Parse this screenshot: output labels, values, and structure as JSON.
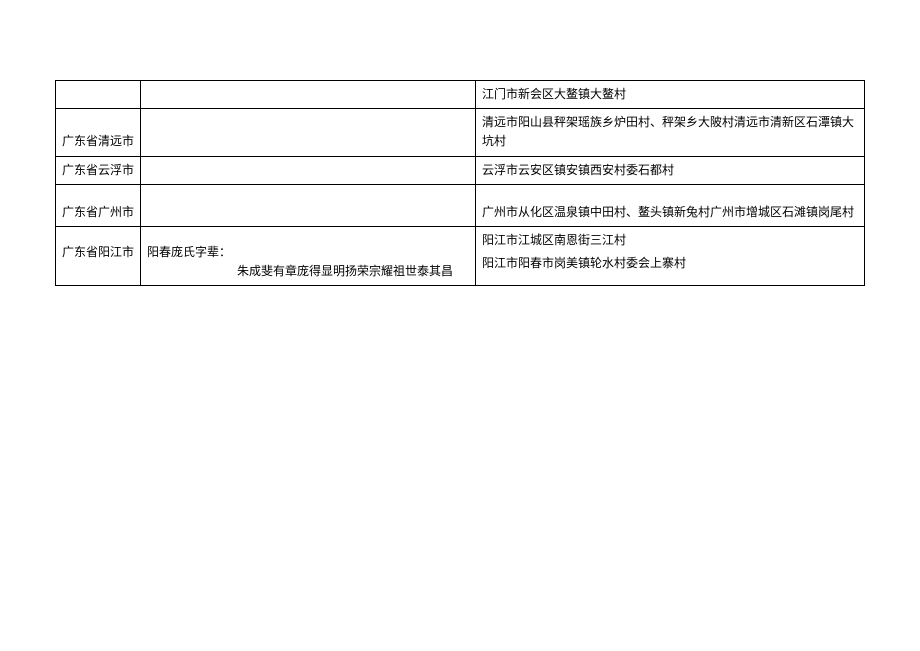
{
  "rows": [
    {
      "col1": "",
      "col2": "",
      "col3": "江门市新会区大鳌镇大鳌村"
    },
    {
      "col1": "广东省清远市",
      "col2": "",
      "col3": "清远市阳山县秤架瑶族乡炉田村、秤架乡大陂村清远市清新区石潭镇大坑村"
    },
    {
      "col1": "广东省云浮市",
      "col2": "",
      "col3": "云浮市云安区镇安镇西安村委石都村"
    },
    {
      "col1": "广东省广州市",
      "col2": "",
      "col3": "广州市从化区温泉镇中田村、鳌头镇新兔村广州市增城区石滩镇岗尾村"
    },
    {
      "col1": "广东省阳江市",
      "col2_line1": "阳春庞氏字辈：",
      "col2_line2": "朱成斐有章庞得显明扬荣宗耀祖世泰其昌",
      "col3_line1": "阳江市江城区南恩街三江村",
      "col3_line2": "阳江市阳春市岗美镇轮水村委会上寨村"
    }
  ]
}
